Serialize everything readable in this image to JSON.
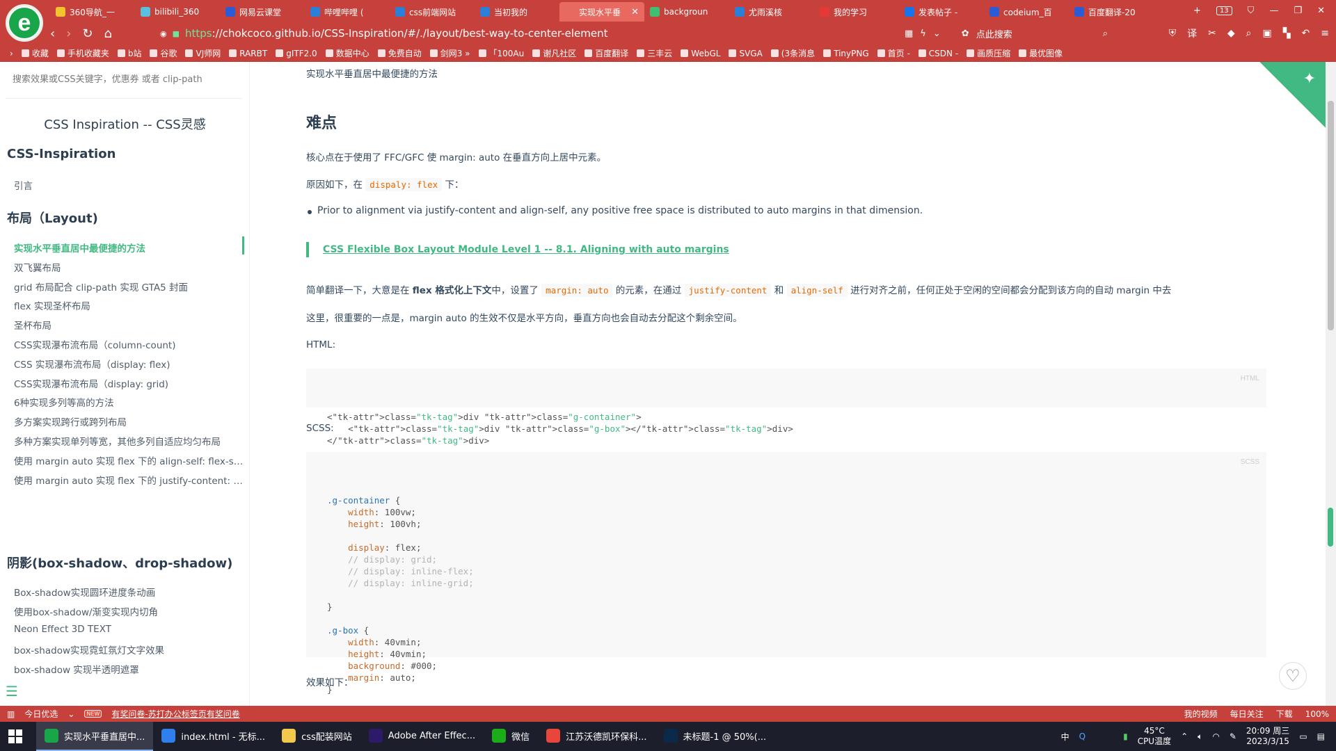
{
  "browser": {
    "tabs": [
      {
        "label": "360导航_一",
        "color": "#f4c430"
      },
      {
        "label": "bilibili_360",
        "color": "#5bc0de"
      },
      {
        "label": "网易云课堂",
        "color": "#2b5cd6"
      },
      {
        "label": "哔哩哔哩 (",
        "color": "#2b7fd6"
      },
      {
        "label": "css前端网站",
        "color": "#2b7fd6"
      },
      {
        "label": "当初我的",
        "color": "#2b7fd6"
      },
      {
        "label": "实现水平垂",
        "color": "#e7695f",
        "active": true
      },
      {
        "label": "backgroun",
        "color": "#3fbf6f"
      },
      {
        "label": "尤雨溪核",
        "color": "#2b7fd6"
      },
      {
        "label": "我的学习",
        "color": "#e53935"
      },
      {
        "label": "发表帖子 -",
        "color": "#1a73e8"
      },
      {
        "label": "codeium_百",
        "color": "#2b5cd6"
      },
      {
        "label": "百度翻译-20",
        "color": "#2b5cd6"
      }
    ],
    "tab_close": "✕",
    "new_tab": "+",
    "tab_count": "13",
    "url_protocol": "https",
    "url_rest": "://chokcoco.github.io/CSS-Inspiration/#/./layout/best-way-to-center-element",
    "search_label": "点此搜索",
    "bookmarks": [
      "收藏",
      "手机收藏夹",
      "b站",
      "谷歌",
      "VJ师网",
      "RARBT",
      "gITF2.0",
      "数据中心",
      "免费自动",
      "剑网3 »",
      "「100Au",
      "谢凡社区",
      "百度翻译",
      "三丰云",
      "WebGL",
      "SVGA",
      "(3条消息",
      "TinyPNG",
      "首页 -",
      "CSDN -",
      "画质压缩",
      "最优图像"
    ]
  },
  "sidebar": {
    "search_placeholder": "搜索效果或CSS关键字，优惠券 或者 clip-path",
    "site_title": "CSS Inspiration -- CSS灵感",
    "section_main": "CSS-Inspiration",
    "intro": "引言",
    "section_layout": "布局（Layout)",
    "layout_items": [
      "实现水平垂直居中最便捷的方法",
      "双飞翼布局",
      "grid 布局配合 clip-path 实现 GTA5 封面",
      "flex 实现圣杯布局",
      "圣杯布局",
      "CSS实现瀑布流布局（column-count)",
      "CSS 实现瀑布流布局（display: flex)",
      "CSS实现瀑布流布局（display: grid)",
      "6种实现多列等高的方法",
      "多方案实现跨行或跨列布局",
      "多种方案实现单列等宽，其他多列自适应均匀布局",
      "使用 margin auto 实现 flex 下的 align-self: flex-start",
      "使用 margin auto 实现 flex 下的 justify-content: space-between"
    ],
    "section_shadow": "阴影(box-shadow、drop-shadow)",
    "shadow_items": [
      "Box-shadow实现圆环进度条动画",
      "使用box-shadow/渐变实现内切角",
      "Neon Effect 3D TEXT",
      "box-shadow实现霓虹氛灯文字效果",
      "box-shadow 实现半透明遮罩"
    ]
  },
  "content": {
    "top_text": "实现水平垂直居中最便捷的方法",
    "heading": "难点",
    "p1": "核心点在于使用了 FFC/GFC 使 margin: auto 在垂直方向上居中元素。",
    "p2_prefix": "原因如下，在",
    "p2_code": "dispaly: flex",
    "p2_suffix": "下：",
    "bullet": "Prior to alignment via justify-content and align-self, any positive free space is distributed to auto margins in that dimension.",
    "quote_link": "CSS Flexible Box Layout Module Level 1 -- 8.1. Aligning with auto margins",
    "p3_a": "简单翻译一下，大意是在",
    "p3_bold": "flex 格式化上下文",
    "p3_b": "中，设置了",
    "p3_code1": "margin: auto",
    "p3_c": "的元素，在通过",
    "p3_code2": "justify-content",
    "p3_d": "和",
    "p3_code3": "align-self",
    "p3_e": "进行对齐之前，任何正处于空闲的空间都会分配到该方向的自动 margin 中去",
    "p4": "这里，很重要的一点是，margin auto 的生效不仅是水平方向，垂直方向也会自动去分配这个剩余空间。",
    "html_label": "HTML:",
    "html_lang": "HTML",
    "html_lines": [
      "<div class=\"g-container\">",
      "    <div class=\"g-box\"></div>",
      "</div>"
    ],
    "scss_label": "SCSS:",
    "scss_lang": "SCSS",
    "scss_lines": [
      ".g-container {",
      "    width: 100vw;",
      "    height: 100vh;",
      "",
      "    display: flex;",
      "    // display: grid;",
      "    // display: inline-flex;",
      "    // display: inline-grid;",
      "",
      "}",
      "",
      ".g-box {",
      "    width: 40vmin;",
      "    height: 40vmin;",
      "    background: #000;",
      "    margin: auto;",
      "}"
    ],
    "result_label": "效果如下："
  },
  "statusbar": {
    "left1": "今日优选",
    "new_badge": "NEW",
    "left2": "有奖问卷-苏打办公标签页有奖问卷",
    "right_items": [
      "我的视频",
      "每日关注",
      "下载",
      "100%"
    ]
  },
  "taskbar": {
    "apps": [
      {
        "label": "实现水平垂直居中...",
        "color": "#19a64a",
        "on": true
      },
      {
        "label": "index.html - 无标...",
        "color": "#2f80ed"
      },
      {
        "label": "css配装网站",
        "color": "#f2c94c"
      },
      {
        "label": "Adobe After Effec...",
        "color": "#2d1b69"
      },
      {
        "label": "微信",
        "color": "#1aad19"
      },
      {
        "label": "江苏沃德凯环保科...",
        "color": "#e8453c"
      },
      {
        "label": "未标题-1 @ 50%(...",
        "color": "#0b2a4a"
      }
    ],
    "ime": "中",
    "temp": "45°C",
    "temp_label": "CPU温度",
    "time": "20:09 周三",
    "date": "2023/3/15"
  },
  "colors": {
    "accent": "#42b983",
    "browser": "#c6413b"
  }
}
